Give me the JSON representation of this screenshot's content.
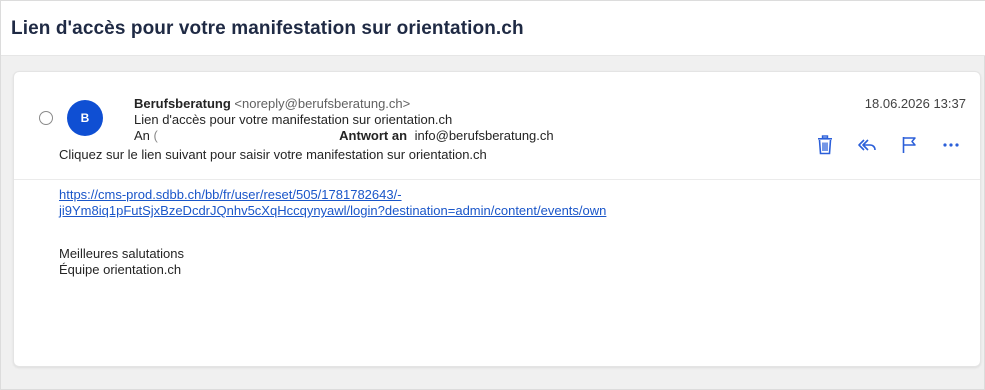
{
  "subject": "Lien d'accès pour votre manifestation sur orientation.ch",
  "message": {
    "avatar_initial": "B",
    "sender_name": "Berufsberatung",
    "sender_email": "<noreply@berufsberatung.ch>",
    "subject_line": "Lien d'accès pour votre manifestation sur orientation.ch",
    "to_label": "An",
    "to_value": "(",
    "reply_to_label": "Antwort an",
    "reply_to_value": "info@berufsberatung.ch",
    "date": "18.06.2026 13:37"
  },
  "actions": [
    {
      "name": "delete-icon"
    },
    {
      "name": "reply-all-icon"
    },
    {
      "name": "flag-icon"
    },
    {
      "name": "more-icon"
    }
  ],
  "body": {
    "intro": "Cliquez sur le lien suivant pour saisir votre manifestation sur orientation.ch",
    "link_line1": "https://cms-prod.sdbb.ch/bb/fr/user/reset/505/1781782643/-",
    "link_line2": "ji9Ym8iq1pFutSjxBzeDcdrJQnhv5cXqHccqynyawl/login?destination=admin/content/events/own",
    "closing_line1": "Meilleures salutations",
    "closing_line2": "Équipe orientation.ch"
  },
  "colors": {
    "accent": "#0f4fd3",
    "link": "#1a56c9",
    "action_icon": "#2b5fd9"
  }
}
